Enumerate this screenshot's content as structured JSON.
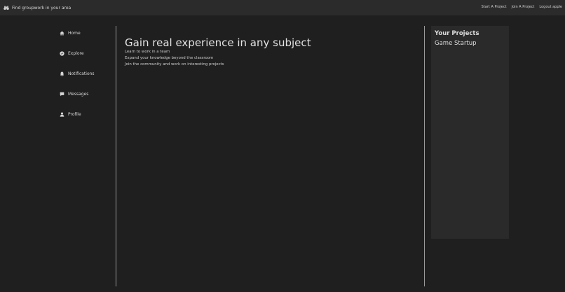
{
  "header": {
    "brand_icon": "binoculars-icon",
    "brand_text": "Find groupwork in your area",
    "links": {
      "start_project": "Start A Project",
      "join_project": "Join A Project",
      "logout": "Logout apple"
    }
  },
  "sidebar": {
    "items": [
      {
        "label": "Home",
        "icon": "home-icon"
      },
      {
        "label": "Explore",
        "icon": "compass-icon"
      },
      {
        "label": "Notifications",
        "icon": "bell-icon"
      },
      {
        "label": "Messages",
        "icon": "chat-icon"
      },
      {
        "label": "Profile",
        "icon": "user-icon"
      }
    ]
  },
  "main": {
    "title": "Gain real experience in any subject",
    "lines": [
      "Learn to work in a team",
      "Expand your knowledge beyond the classroom",
      "Join the community and work on interesting projects"
    ]
  },
  "projects": {
    "heading": "Your Projects",
    "items": [
      "Game Startup"
    ]
  },
  "colors": {
    "background": "#1f1f1f",
    "header": "#2b2b2b",
    "panel": "#2a2a2a",
    "divider": "#9a9a9a",
    "text": "#d9d9d9"
  }
}
